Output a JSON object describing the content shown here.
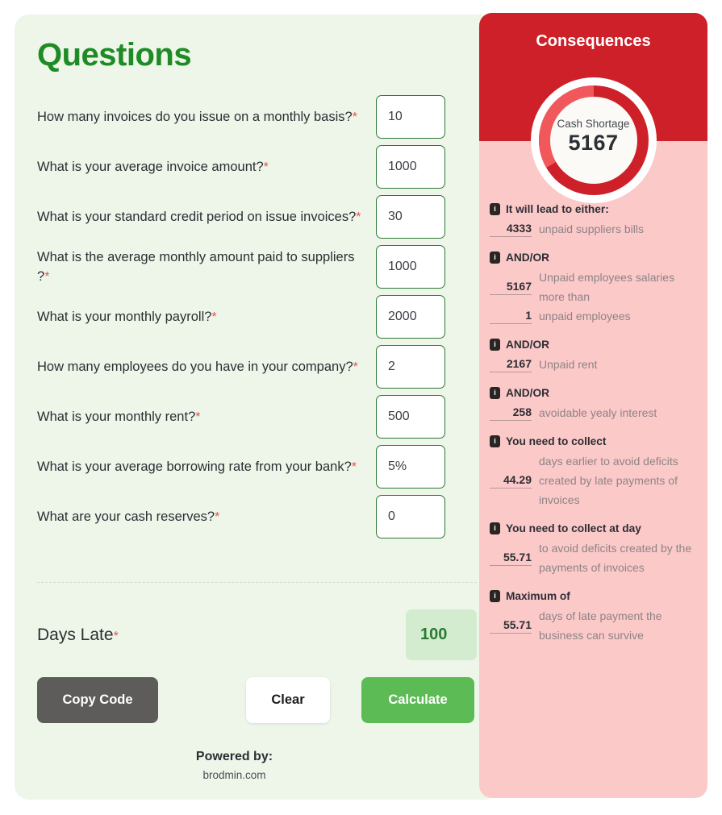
{
  "questions_panel": {
    "title": "Questions",
    "required_marker": "*",
    "questions": [
      {
        "label": "How many invoices do you issue on a monthly basis?",
        "value": "10",
        "name": "invoices-per-month"
      },
      {
        "label": "What is your average invoice amount?",
        "value": "1000",
        "name": "average-invoice-amount"
      },
      {
        "label": "What is your standard credit period on issue invoices?",
        "value": "30",
        "name": "credit-period"
      },
      {
        "label": "What is the average monthly amount paid to suppliers ?",
        "value": "1000",
        "name": "monthly-supplier-payments"
      },
      {
        "label": "What is your monthly payroll?",
        "value": "2000",
        "name": "monthly-payroll"
      },
      {
        "label": "How many employees do you have in your company?",
        "value": "2",
        "name": "employee-count"
      },
      {
        "label": "What is your monthly rent?",
        "value": "500",
        "name": "monthly-rent"
      },
      {
        "label": "What is your average borrowing rate from your bank?",
        "value": "5%",
        "name": "borrowing-rate"
      },
      {
        "label": "What are your cash reserves?",
        "value": "0",
        "name": "cash-reserves"
      }
    ],
    "days_late": {
      "label": "Days Late",
      "value": "100"
    },
    "buttons": {
      "copy_code": "Copy Code",
      "clear": "Clear",
      "calculate": "Calculate"
    },
    "footer": {
      "powered_by_label": "Powered by:",
      "powered_by_site": "brodmin.com"
    }
  },
  "consequences_panel": {
    "title": "Consequences",
    "gauge": {
      "label": "Cash Shortage",
      "value": "5167"
    },
    "info_icon_glyph": "i",
    "items": [
      {
        "heading": "It will lead to either:",
        "value": "4333",
        "description": "unpaid suppliers bills"
      },
      {
        "heading": "AND/OR",
        "value": "5167",
        "description": "Unpaid employees salaries more than",
        "value2": "1",
        "description2": "unpaid employees"
      },
      {
        "heading": "AND/OR",
        "value": "2167",
        "description": "Unpaid rent"
      },
      {
        "heading": "AND/OR",
        "value": "258",
        "description": "avoidable yealy interest"
      },
      {
        "heading": "You need to collect",
        "value": "44.29",
        "description": "days earlier to avoid deficits created by late payments of invoices"
      },
      {
        "heading": "You need to collect at day",
        "value": "55.71",
        "description": "to avoid deficits created by the payments of invoices"
      },
      {
        "heading": "Maximum of",
        "value": "55.71",
        "description": "days of late payment the business can survive"
      }
    ]
  },
  "colors": {
    "brand_green": "#1f8b25",
    "panel_green_bg": "#eef6ea",
    "accent_red": "#ce2028",
    "panel_pink_bg": "#fcc9c9",
    "required_star": "#e8524a",
    "calculate_button": "#5cbb54",
    "copy_button": "#5e5c5a"
  }
}
